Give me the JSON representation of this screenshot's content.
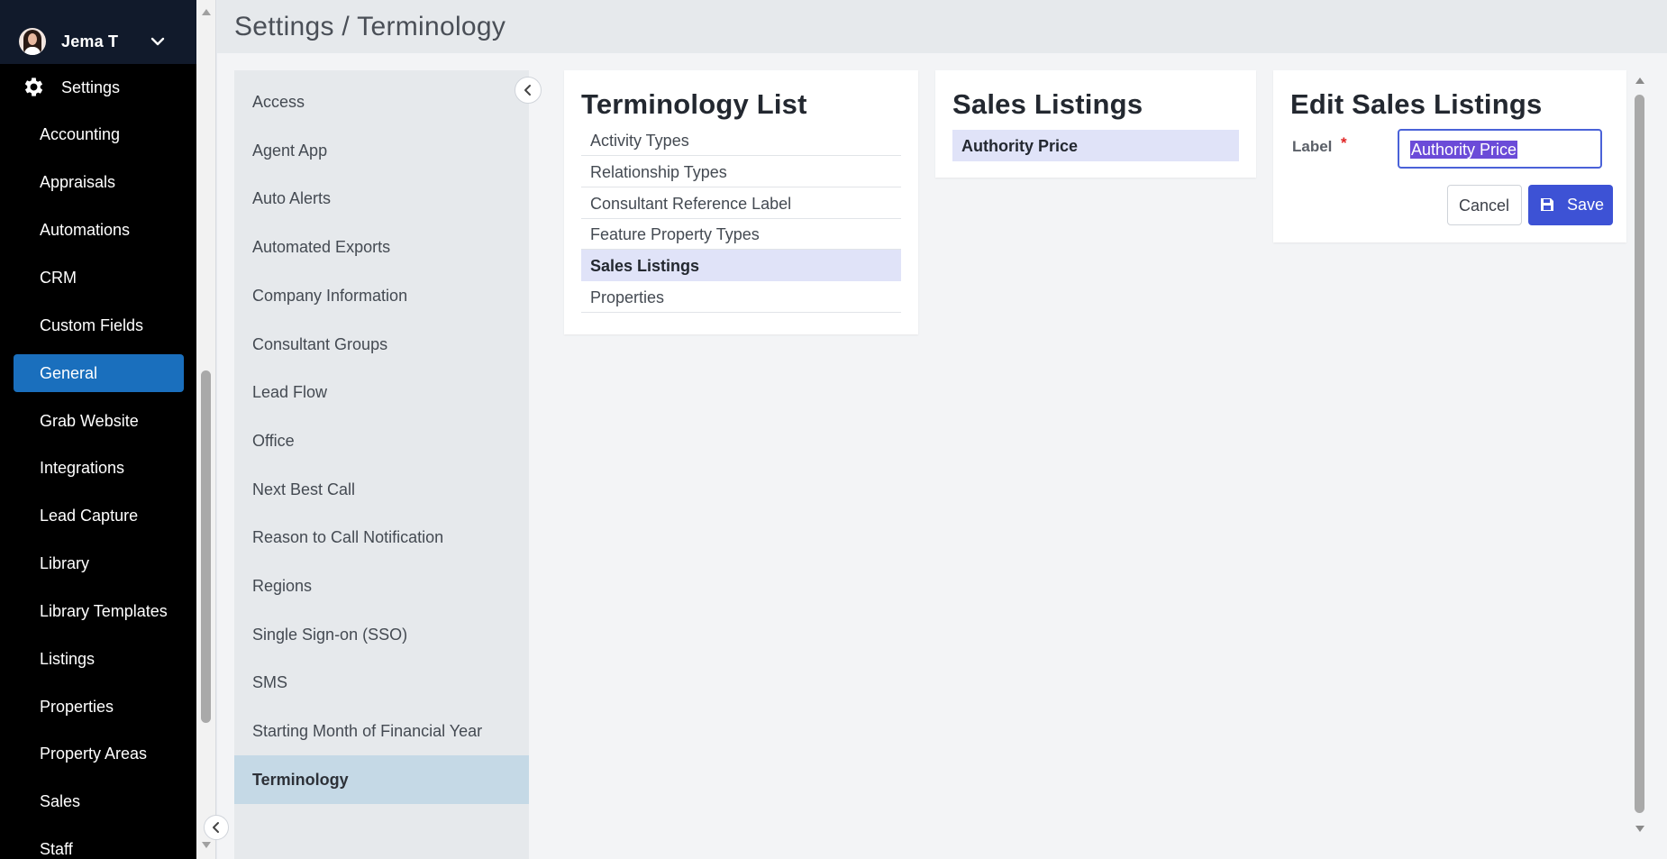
{
  "user": {
    "name": "Jema T"
  },
  "sidebar": {
    "settings_label": "Settings",
    "items": [
      {
        "label": "Accounting",
        "active": false
      },
      {
        "label": "Appraisals",
        "active": false
      },
      {
        "label": "Automations",
        "active": false
      },
      {
        "label": "CRM",
        "active": false
      },
      {
        "label": "Custom Fields",
        "active": false
      },
      {
        "label": "General",
        "active": true
      },
      {
        "label": "Grab Website",
        "active": false
      },
      {
        "label": "Integrations",
        "active": false
      },
      {
        "label": "Lead Capture",
        "active": false
      },
      {
        "label": "Library",
        "active": false
      },
      {
        "label": "Library Templates",
        "active": false
      },
      {
        "label": "Listings",
        "active": false
      },
      {
        "label": "Properties",
        "active": false
      },
      {
        "label": "Property Areas",
        "active": false
      },
      {
        "label": "Sales",
        "active": false
      },
      {
        "label": "Staff",
        "active": false
      }
    ]
  },
  "header": {
    "title": "Settings / Terminology"
  },
  "submenu": {
    "items": [
      {
        "label": "Access",
        "active": false
      },
      {
        "label": "Agent App",
        "active": false
      },
      {
        "label": "Auto Alerts",
        "active": false
      },
      {
        "label": "Automated Exports",
        "active": false
      },
      {
        "label": "Company Information",
        "active": false
      },
      {
        "label": "Consultant Groups",
        "active": false
      },
      {
        "label": "Lead Flow",
        "active": false
      },
      {
        "label": "Office",
        "active": false
      },
      {
        "label": "Next Best Call",
        "active": false
      },
      {
        "label": "Reason to Call Notification",
        "active": false
      },
      {
        "label": "Regions",
        "active": false
      },
      {
        "label": "Single Sign-on (SSO)",
        "active": false
      },
      {
        "label": "SMS",
        "active": false
      },
      {
        "label": "Starting Month of Financial Year",
        "active": false
      },
      {
        "label": "Terminology",
        "active": true
      }
    ]
  },
  "terminology_list": {
    "title": "Terminology List",
    "items": [
      {
        "label": "Activity Types",
        "active": false
      },
      {
        "label": "Relationship Types",
        "active": false
      },
      {
        "label": "Consultant Reference Label",
        "active": false
      },
      {
        "label": "Feature Property Types",
        "active": false
      },
      {
        "label": "Sales Listings",
        "active": true
      },
      {
        "label": "Properties",
        "active": false
      }
    ]
  },
  "sales_listings": {
    "title": "Sales Listings",
    "items": [
      {
        "label": "Authority Price",
        "active": true
      }
    ]
  },
  "edit_panel": {
    "title": "Edit Sales Listings",
    "label_field": {
      "label": "Label",
      "required_marker": "*",
      "value": "Authority Price"
    },
    "cancel_label": "Cancel",
    "save_label": "Save"
  },
  "colors": {
    "sidebar_bg": "#000000",
    "nav_active": "#1a6fbd",
    "submenu_active": "#c5d9e6",
    "list_active": "#e0e3f8",
    "primary_button": "#3d52d5",
    "required": "#e02424"
  }
}
